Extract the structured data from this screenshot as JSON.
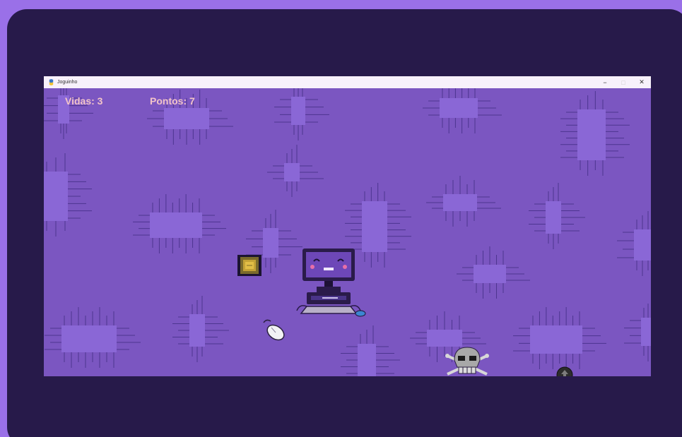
{
  "window": {
    "title": "Joguinho",
    "controls": {
      "minimize": "−",
      "maximize": "□",
      "close": "✕"
    }
  },
  "hud": {
    "lives_label": "Vidas: 3",
    "points_label": "Pontos: 7"
  },
  "sprites": {
    "player": "computer-character",
    "items": [
      "cpu-chip",
      "computer-mouse"
    ],
    "enemies": [
      "skull-crossbones",
      "bomb"
    ]
  },
  "colors": {
    "page_background": "#9a70e8",
    "frame": "#271a4a",
    "game_background": "#7b56c1",
    "circuit_chip": "#8a67d6",
    "circuit_line": "#4d3590",
    "hud_text": "#f2c4c8",
    "titlebar": "#f7f1fb"
  }
}
